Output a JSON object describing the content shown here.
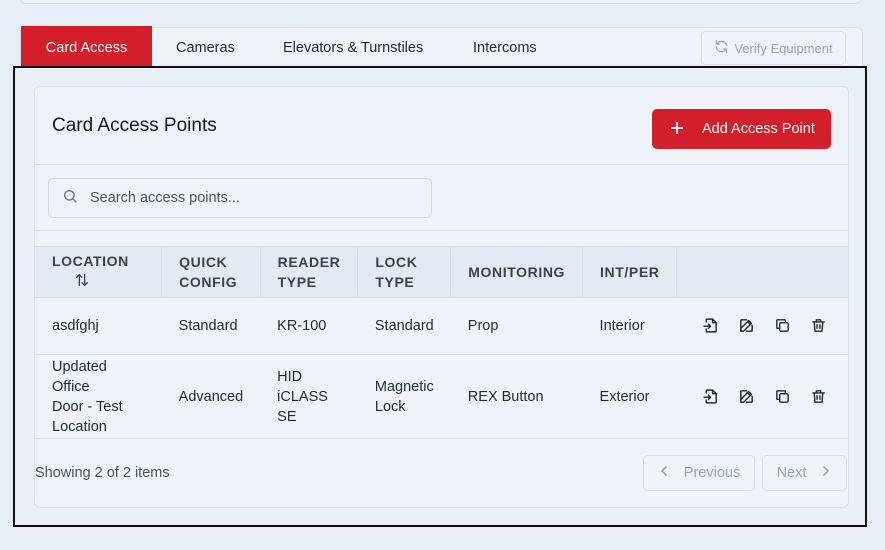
{
  "tabs": [
    {
      "label": "Card Access",
      "active": true
    },
    {
      "label": "Cameras",
      "active": false
    },
    {
      "label": "Elevators & Turnstiles",
      "active": false
    },
    {
      "label": "Intercoms",
      "active": false
    }
  ],
  "verify_button": {
    "label": "Verify Equipment",
    "icon": "refresh-icon"
  },
  "card": {
    "title": "Card Access Points",
    "add_button": {
      "label": "Add Access Point",
      "icon": "plus-icon"
    }
  },
  "search": {
    "placeholder": "Search access points...",
    "value": "",
    "icon": "search-icon"
  },
  "table": {
    "headers": {
      "location": "LOCATION",
      "quick_config_1": "QUICK",
      "quick_config_2": "CONFIG",
      "reader_type_1": "READER",
      "reader_type_2": "TYPE",
      "lock_type_1": "LOCK",
      "lock_type_2": "TYPE",
      "monitoring": "MONITORING",
      "int_per": "INT/PER"
    },
    "rows": [
      {
        "location": [
          "asdfghj"
        ],
        "quick_config": "Standard",
        "reader_type": [
          "KR-100"
        ],
        "lock_type": [
          "Standard"
        ],
        "monitoring": "Prop",
        "int_per": "Interior"
      },
      {
        "location": [
          "Updated Office",
          "Door - Test",
          "Location"
        ],
        "quick_config": "Advanced",
        "reader_type": [
          "HID",
          "iCLASS",
          "SE"
        ],
        "lock_type": [
          "Magnetic",
          "Lock"
        ],
        "monitoring": "REX Button",
        "int_per": "Exterior"
      }
    ],
    "row_action_icons": [
      "file-import-icon",
      "edit-icon",
      "copy-icon",
      "trash-icon"
    ]
  },
  "footer": {
    "showing_text": "Showing 2 of 2 items",
    "previous_label": "Previous",
    "next_label": "Next"
  },
  "colors": {
    "accent": "#d21f2b",
    "background": "#e8eef6",
    "panel": "#eef3fa"
  }
}
